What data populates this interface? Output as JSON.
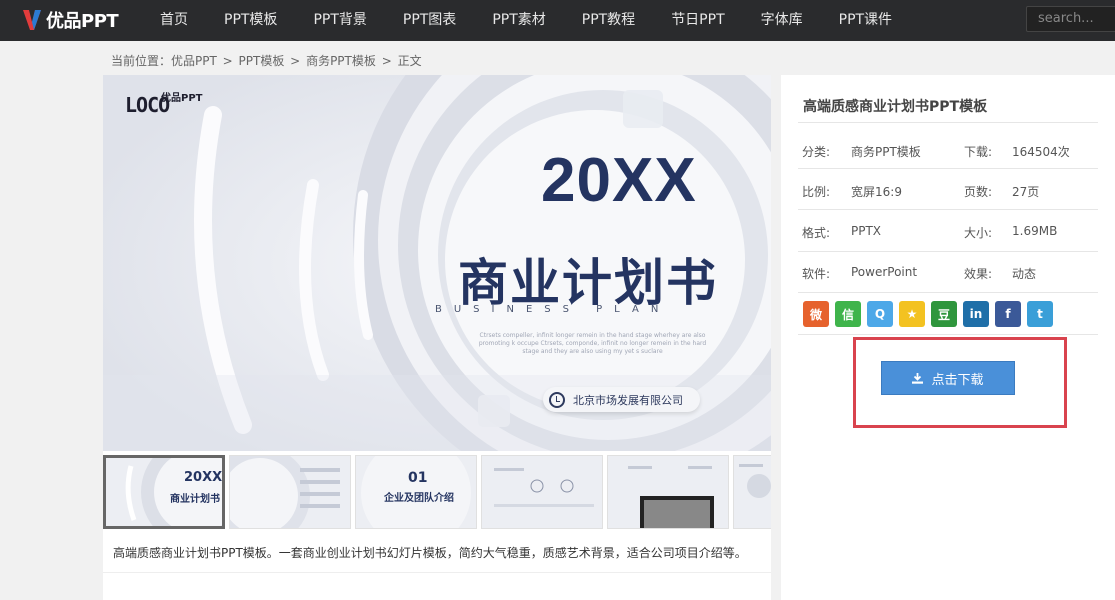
{
  "brand": {
    "name": "优品PPT"
  },
  "nav": {
    "items": [
      "首页",
      "PPT模板",
      "PPT背景",
      "PPT图表",
      "PPT素材",
      "PPT教程",
      "节日PPT",
      "字体库",
      "PPT课件"
    ],
    "search_placeholder": "search..."
  },
  "breadcrumb": [
    "当前位置：优品PPT",
    ">",
    "PPT模板",
    ">",
    "商务PPT模板",
    ">",
    "正文"
  ],
  "preview": {
    "logo_text": "LOCO",
    "logo_sub": "优品PPT",
    "year": "20XX",
    "title_cn": "商业计划书",
    "title_en": "BUSINESS PLAN",
    "filler": "Ctrsets compeller, infinit longer remein in the hand stage wherhey are also promoting k occupe Ctrsets, componde, infinit no longer remein in the hard stage and they are also using my yet s suclare",
    "company": "北京市场发展有限公司"
  },
  "thumbnails": [
    {
      "title": "20XX",
      "sub": "商业计划书"
    },
    {
      "title": "",
      "sub": ""
    },
    {
      "title": "01",
      "sub": "企业及团队介绍"
    },
    {
      "title": "",
      "sub": ""
    },
    {
      "title": "",
      "sub": ""
    },
    {
      "title": "",
      "sub": ""
    }
  ],
  "description": "高端质感商业计划书PPT模板。一套商业创业计划书幻灯片模板，简约大气稳重，质感艺术背景，适合公司项目介绍等。",
  "sidebar": {
    "title": "高端质感商业计划书PPT模板",
    "rows": [
      {
        "l1": "分类:",
        "v1": "商务PPT模板",
        "l2": "下载:",
        "v2": "164504次"
      },
      {
        "l1": "比例:",
        "v1": "宽屏16:9",
        "l2": "页数:",
        "v2": "27页"
      },
      {
        "l1": "格式:",
        "v1": "PPTX",
        "l2": "大小:",
        "v2": "1.69MB"
      },
      {
        "l1": "软件:",
        "v1": "PowerPoint",
        "l2": "效果:",
        "v2": "动态"
      }
    ],
    "shares": [
      {
        "name": "weibo",
        "glyph": "微",
        "color": "#e6622d"
      },
      {
        "name": "wechat",
        "glyph": "信",
        "color": "#3fb44b"
      },
      {
        "name": "qq",
        "glyph": "Q",
        "color": "#4da8e8"
      },
      {
        "name": "qzone",
        "glyph": "★",
        "color": "#f3c221"
      },
      {
        "name": "douban",
        "glyph": "豆",
        "color": "#2f963d"
      },
      {
        "name": "linkedin",
        "glyph": "in",
        "color": "#1f6fa8"
      },
      {
        "name": "facebook",
        "glyph": "f",
        "color": "#3b5998"
      },
      {
        "name": "twitter",
        "glyph": "t",
        "color": "#3a9fd8"
      }
    ],
    "download_label": "点击下载"
  }
}
